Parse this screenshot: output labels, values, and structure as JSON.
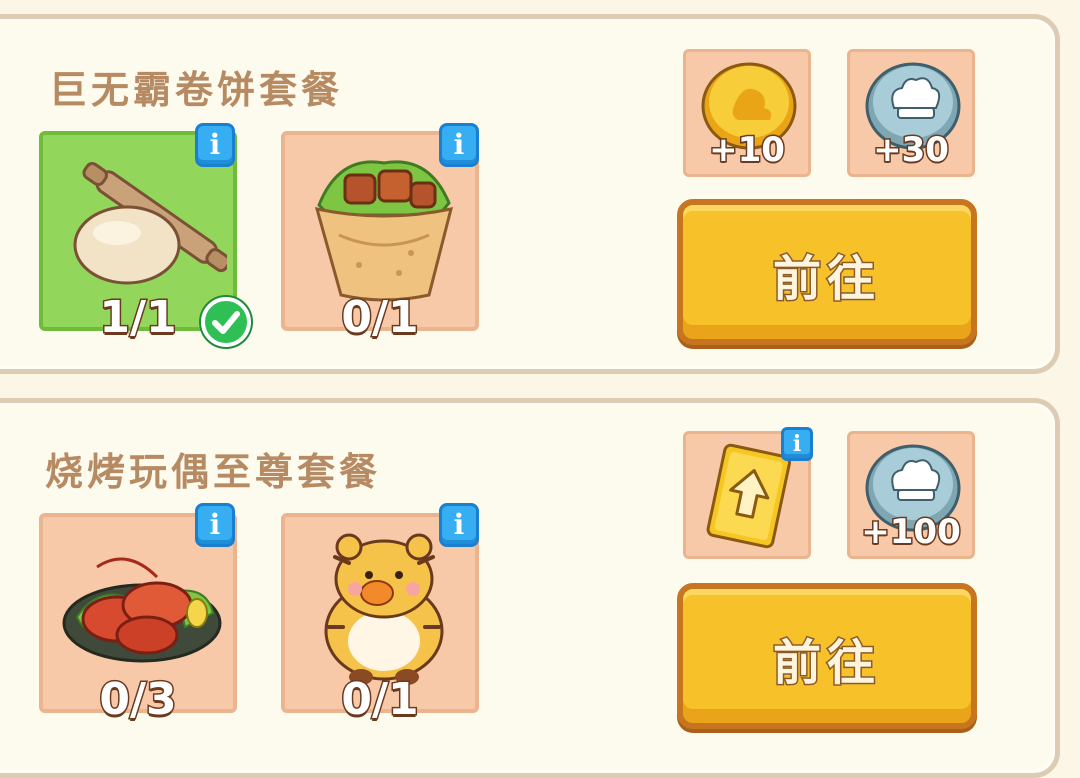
{
  "packs": [
    {
      "title": "巨无霸卷饼套餐",
      "items": [
        {
          "name": "dough-with-rolling-pin",
          "count": "1/1",
          "completed": true
        },
        {
          "name": "wrap-burrito",
          "count": "0/1",
          "completed": false
        }
      ],
      "rewards": [
        {
          "icon": "gold-coin-icon",
          "amount": "+10"
        },
        {
          "icon": "chef-hat-coin-icon",
          "amount": "+30"
        }
      ],
      "button_label": "前往"
    },
    {
      "title": "烧烤玩偶至尊套餐",
      "items": [
        {
          "name": "crayfish-plate",
          "count": "0/3",
          "completed": false
        },
        {
          "name": "tiger-plush-doll",
          "count": "0/1",
          "completed": false
        }
      ],
      "rewards": [
        {
          "icon": "upgrade-card-icon",
          "amount": ""
        },
        {
          "icon": "chef-hat-coin-icon",
          "amount": "+100"
        }
      ],
      "button_label": "前往"
    }
  ],
  "colors": {
    "background": "#fbf6e6",
    "slot": "#f8c9a8",
    "slot_done": "#93d65c",
    "button": "#f7c12a",
    "info": "#37aef2"
  }
}
